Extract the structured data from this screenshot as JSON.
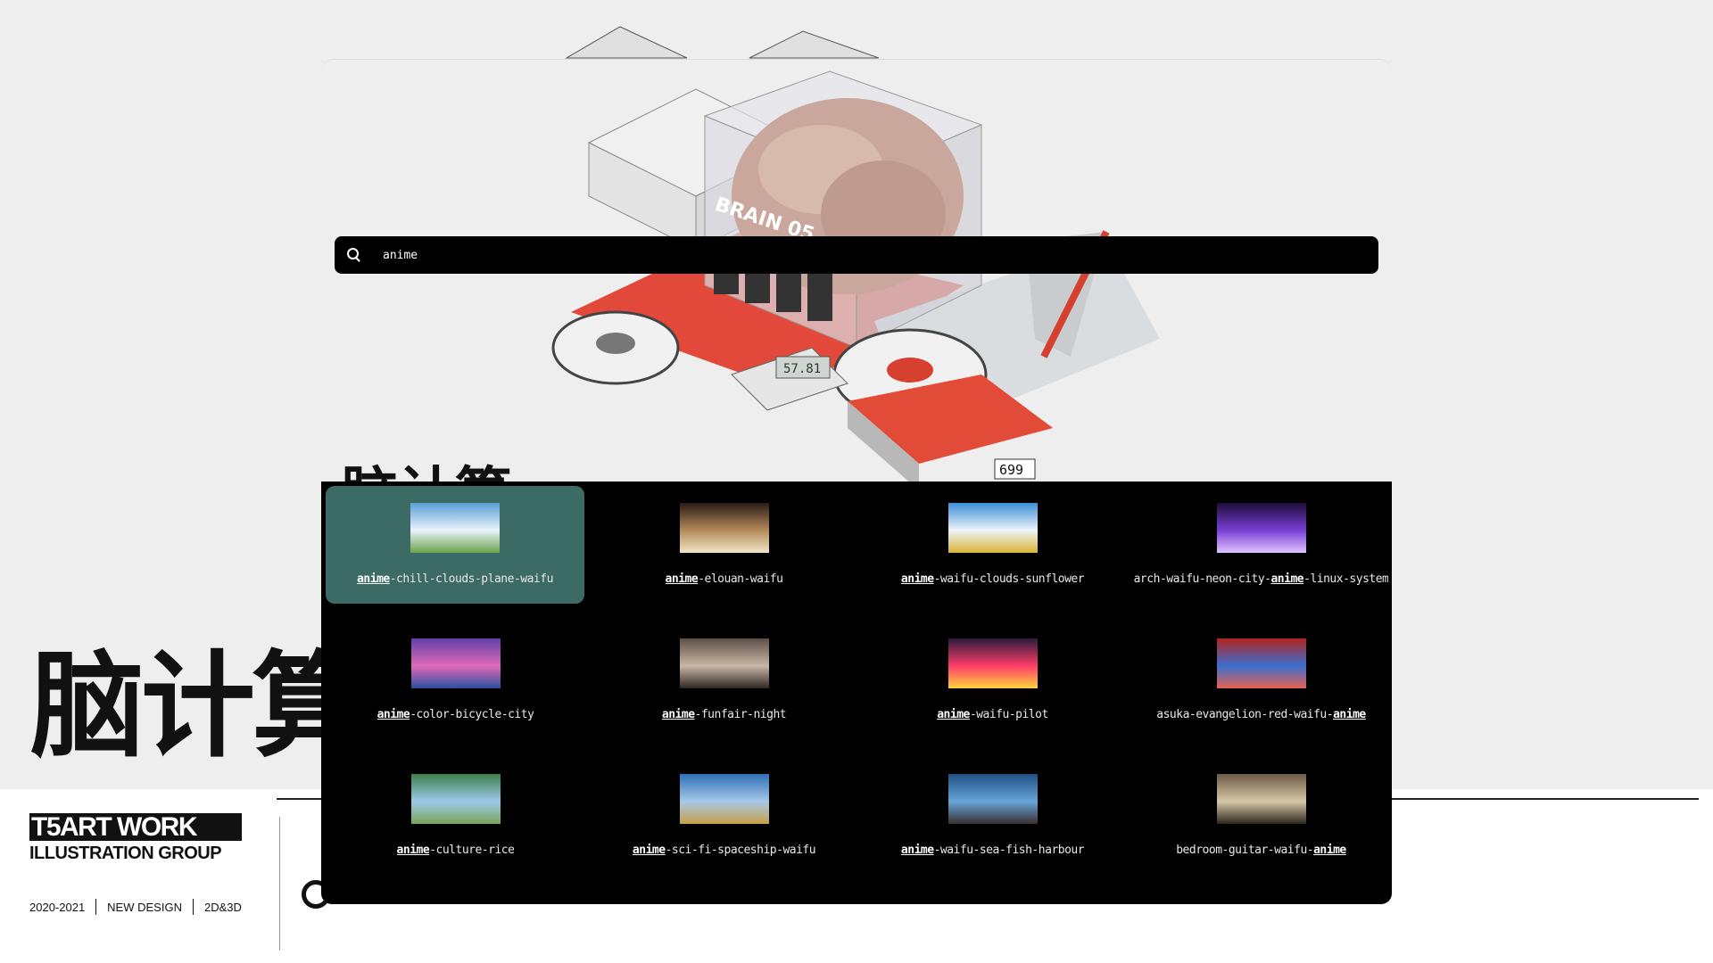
{
  "wallpaper": {
    "big_title": "脑计算",
    "brand": "T5ART WORK",
    "brand_sub": "ILLUSTRATION GROUP",
    "meta": [
      "2020-2021",
      "NEW DESIGN",
      "2D&3D"
    ],
    "art_label": "BRAIN 05",
    "art_counter": "699",
    "art_display": "57.81"
  },
  "search": {
    "query": "anime"
  },
  "results": [
    {
      "prefix": "",
      "match": "anime",
      "suffix": "-chill-clouds-plane-waifu",
      "selected": true,
      "palette": [
        "#5a9fd6",
        "#e9f2fa",
        "#6aa24a"
      ]
    },
    {
      "prefix": "",
      "match": "anime",
      "suffix": "-elouan-waifu",
      "selected": false,
      "palette": [
        "#2a1c15",
        "#b58a5b",
        "#f2e6c8"
      ]
    },
    {
      "prefix": "",
      "match": "anime",
      "suffix": "-waifu-clouds-sunflower",
      "selected": false,
      "palette": [
        "#3c8fd9",
        "#eef4f8",
        "#d9b334"
      ]
    },
    {
      "prefix": "arch-waifu-neon-city-",
      "match": "anime",
      "suffix": "-linux-system",
      "selected": false,
      "palette": [
        "#1c0d36",
        "#7a3fd6",
        "#e0c3ff"
      ]
    },
    {
      "prefix": "",
      "match": "anime",
      "suffix": "-color-bicycle-city",
      "selected": false,
      "palette": [
        "#5e3fa8",
        "#e069b8",
        "#2b4fa0"
      ]
    },
    {
      "prefix": "",
      "match": "anime",
      "suffix": "-funfair-night",
      "selected": false,
      "palette": [
        "#5a4f48",
        "#c8b7a6",
        "#2d2622"
      ]
    },
    {
      "prefix": "",
      "match": "anime",
      "suffix": "-waifu-pilot",
      "selected": false,
      "palette": [
        "#2a1a3a",
        "#ff3d6b",
        "#ffd23d"
      ]
    },
    {
      "prefix": "asuka-evangelion-red-waifu-",
      "match": "anime",
      "suffix": "",
      "selected": false,
      "palette": [
        "#b1231d",
        "#3b6fd0",
        "#e56252"
      ]
    },
    {
      "prefix": "",
      "match": "anime",
      "suffix": "-culture-rice",
      "selected": false,
      "palette": [
        "#3d7f4a",
        "#9dc9e8",
        "#79a559"
      ]
    },
    {
      "prefix": "",
      "match": "anime",
      "suffix": "-sci-fi-spaceship-waifu",
      "selected": false,
      "palette": [
        "#2e6fb6",
        "#a7c8e8",
        "#c7a04a"
      ]
    },
    {
      "prefix": "",
      "match": "anime",
      "suffix": "-waifu-sea-fish-harbour",
      "selected": false,
      "palette": [
        "#1f4f82",
        "#67a6d8",
        "#3a3030"
      ]
    },
    {
      "prefix": "bedroom-guitar-waifu-",
      "match": "anime",
      "suffix": "",
      "selected": false,
      "palette": [
        "#6b5a44",
        "#d6c8a9",
        "#2e261d"
      ]
    }
  ]
}
